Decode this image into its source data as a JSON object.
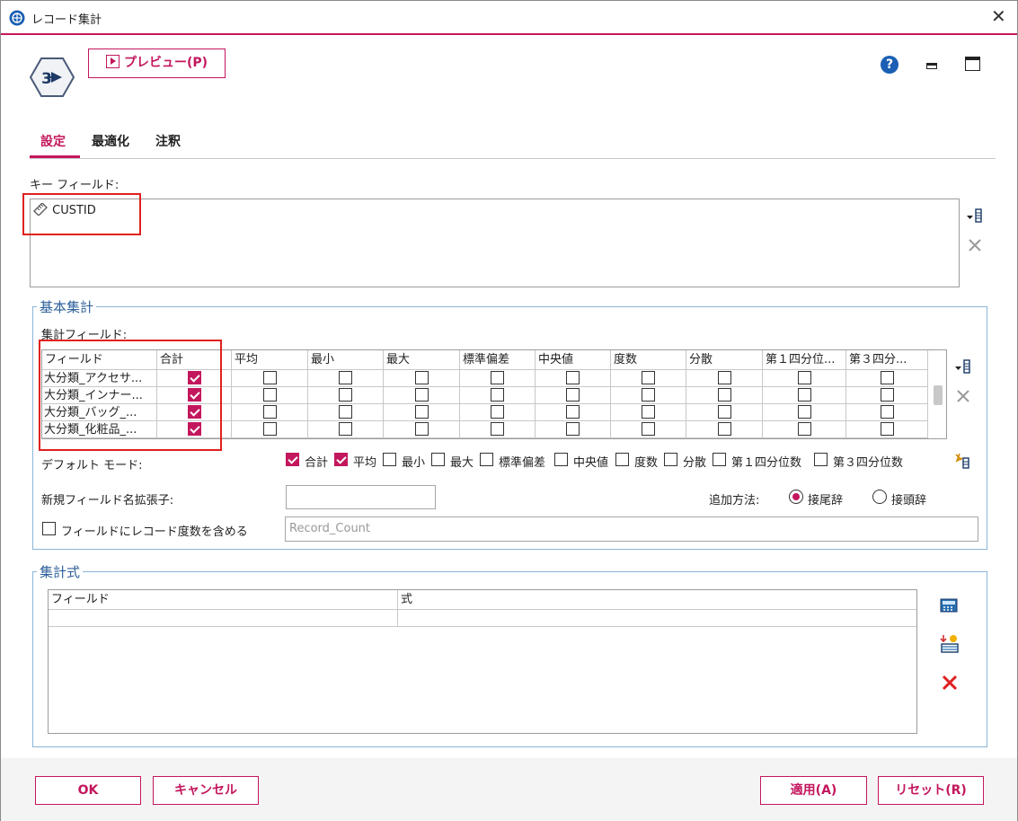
{
  "window": {
    "title": "レコード集計",
    "close_glyph": "✕"
  },
  "toolbar": {
    "preview_label": "プレビュー(P)",
    "help_glyph": "?"
  },
  "tabs": [
    {
      "label": "設定"
    },
    {
      "label": "最適化"
    },
    {
      "label": "注釈"
    }
  ],
  "key_fields": {
    "label": "キー フィールド:",
    "items": [
      "CUSTID"
    ]
  },
  "basic_agg": {
    "title": "基本集計",
    "fields_label": "集計フィールド:",
    "columns": [
      "フィールド",
      "合計",
      "平均",
      "最小",
      "最大",
      "標準偏差",
      "中央値",
      "度数",
      "分散",
      "第１四分位...",
      "第３四分..."
    ],
    "rows": [
      {
        "field": "大分類_アクセサ...",
        "checks": [
          true,
          false,
          false,
          false,
          false,
          false,
          false,
          false,
          false,
          false
        ]
      },
      {
        "field": "大分類_インナー...",
        "checks": [
          true,
          false,
          false,
          false,
          false,
          false,
          false,
          false,
          false,
          false
        ]
      },
      {
        "field": "大分類_バッグ_...",
        "checks": [
          true,
          false,
          false,
          false,
          false,
          false,
          false,
          false,
          false,
          false
        ]
      },
      {
        "field": "大分類_化粧品_...",
        "checks": [
          true,
          false,
          false,
          false,
          false,
          false,
          false,
          false,
          false,
          false
        ]
      }
    ],
    "default_mode_label": "デフォルト モード:",
    "default_modes": [
      {
        "label": "合計",
        "checked": true
      },
      {
        "label": "平均",
        "checked": true
      },
      {
        "label": "最小",
        "checked": false
      },
      {
        "label": "最大",
        "checked": false
      },
      {
        "label": "標準偏差",
        "checked": false
      },
      {
        "label": "中央値",
        "checked": false
      },
      {
        "label": "度数",
        "checked": false
      },
      {
        "label": "分散",
        "checked": false
      },
      {
        "label": "第１四分位数",
        "checked": false
      },
      {
        "label": "第３四分位数",
        "checked": false
      }
    ],
    "suffix_label": "新規フィールド名拡張子:",
    "suffix_value": "",
    "append_label": "追加方法:",
    "append_options": [
      {
        "label": "接尾辞",
        "selected": true
      },
      {
        "label": "接頭辞",
        "selected": false
      }
    ],
    "include_count_label": "フィールドにレコード度数を含める",
    "include_count_checked": false,
    "count_field_placeholder": "Record_Count"
  },
  "agg_expr": {
    "title": "集計式",
    "columns": [
      "フィールド",
      "式"
    ]
  },
  "buttons": {
    "ok": "OK",
    "cancel": "キャンセル",
    "apply": "適用(A)",
    "reset": "リセット(R)"
  },
  "colors": {
    "accent": "#c3175d",
    "group_border": "#8ab4d8",
    "highlight": "#e02020"
  }
}
